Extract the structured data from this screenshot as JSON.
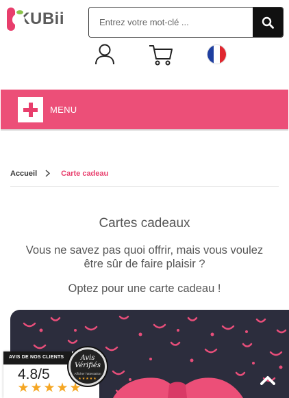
{
  "header": {
    "logo_text": "KUBii",
    "search_placeholder": "Entrez votre mot-clé ...",
    "icons": [
      "user-icon",
      "cart-icon",
      "french-flag-icon",
      "search-icon"
    ]
  },
  "menu": {
    "label": "MENU",
    "toggle_icon": "plus-icon"
  },
  "breadcrumb": {
    "home": "Accueil",
    "current": "Carte cadeau"
  },
  "content": {
    "title": "Cartes cadeaux",
    "lead": "Vous ne savez pas quoi offrir, mais vous voulez être sûr de faire plaisir ?",
    "cta": "Optez pour une carte cadeau !"
  },
  "reviews": {
    "header": "AVIS DE NOS CLIENTS",
    "score": "4.8/5",
    "rating": 4.8,
    "seal_title_1": "Avis",
    "seal_title_2": "Vérifiés",
    "seal_subtitle": "Afficher l'attestation"
  },
  "colors": {
    "brand_pink": "#e83e6c",
    "menu_bar": "#ec4f78",
    "banner_bg": "#2c2d3d",
    "star": "#f5a623"
  }
}
